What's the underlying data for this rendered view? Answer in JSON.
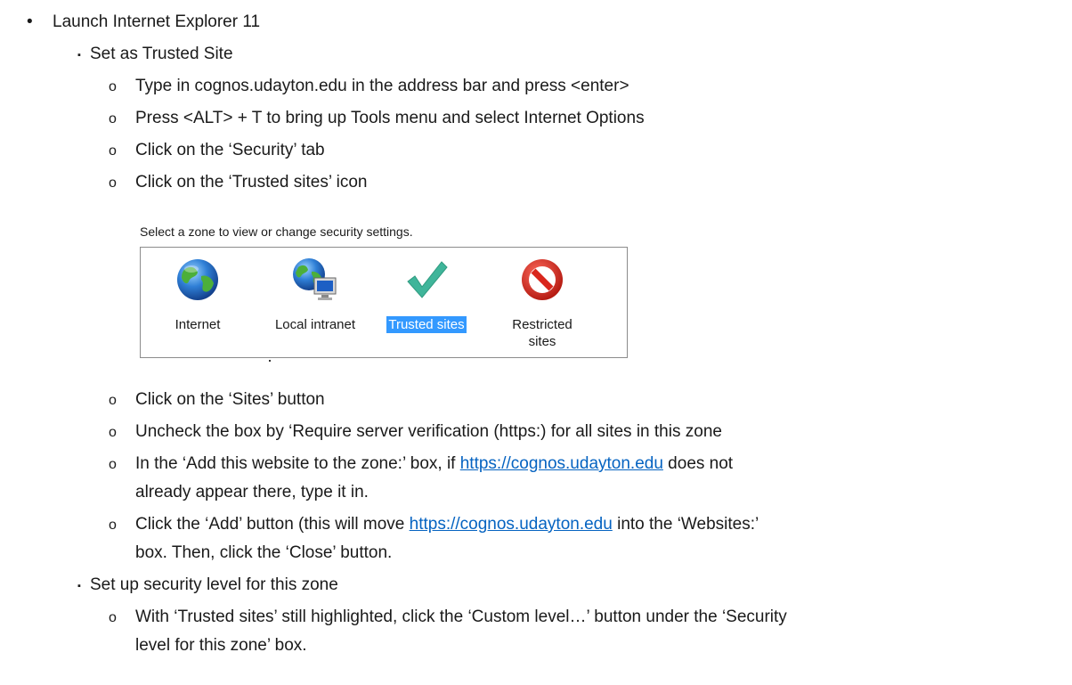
{
  "steps": {
    "launch": "Launch Internet Explorer 11",
    "trusted_heading": "Set as Trusted Site",
    "type_address": "Type in cognos.udayton.edu in the address bar and press <enter>",
    "press_alt": "Press <ALT> + T to bring up Tools menu and select Internet Options",
    "click_security": "Click on the ‘Security’ tab",
    "click_trusted_icon": "Click on the ‘Trusted sites’ icon",
    "click_sites": "Click on the ‘Sites’ button",
    "uncheck_box": "Uncheck the box by ‘Require server verification (https:) for all sites in this zone",
    "add_site_a": "In the ‘Add this website to the zone:’ box, if ",
    "add_site_link": "https://cognos.udayton.edu",
    "add_site_b": " does not",
    "add_site_c": "already appear there, type it in.",
    "click_add_a": "Click the ‘Add’ button (this will move ",
    "click_add_link": "https://cognos.udayton.edu",
    "click_add_b": " into the ‘Websites:’",
    "click_add_c": "box.  Then, click the ‘Close’ button.",
    "security_heading": "Set up security level for this zone",
    "custom_level_a": "With ‘Trusted sites’ still highlighted, click the ‘Custom level…’ button under the ‘Security",
    "custom_level_b": "level for this zone’ box."
  },
  "bullets": {
    "dot": "•",
    "square": "▪",
    "circle": "o"
  },
  "zone_panel": {
    "caption": "Select a zone to view or change security settings.",
    "zones": [
      {
        "label": "Internet",
        "icon": "globe-icon",
        "selected": false
      },
      {
        "label": "Local intranet",
        "icon": "intranet-globe-icon",
        "selected": false
      },
      {
        "label": "Trusted sites",
        "icon": "checkmark-icon",
        "selected": true
      },
      {
        "label_line1": "Restricted",
        "label_line2": "sites",
        "icon": "restricted-icon",
        "selected": false
      }
    ]
  },
  "colors": {
    "link": "#0563c1",
    "selection": "#3399ff",
    "check": "#3fb59a",
    "restricted": "#d9261c"
  }
}
